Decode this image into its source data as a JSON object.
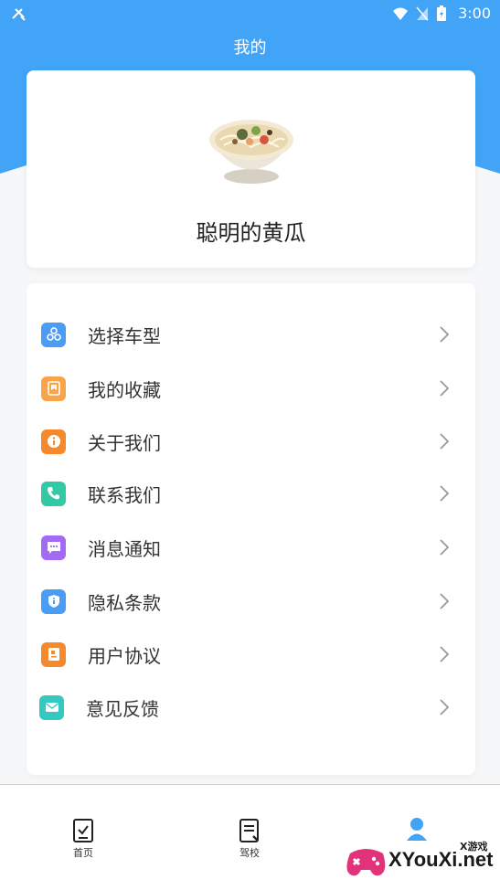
{
  "status_bar": {
    "time": "3:00"
  },
  "header": {
    "title": "我的"
  },
  "profile": {
    "username": "聪明的黄瓜",
    "avatar": "noodle-bowl-avatar"
  },
  "menu": {
    "items": [
      {
        "label": "选择车型",
        "icon": "car-model-icon",
        "color": "#4a9cf5"
      },
      {
        "label": "我的收藏",
        "icon": "bookmark-icon",
        "color": "#f7a44a"
      },
      {
        "label": "关于我们",
        "icon": "info-icon",
        "color": "#f5892d"
      },
      {
        "label": "联系我们",
        "icon": "phone-icon",
        "color": "#34c9a5"
      },
      {
        "label": "消息通知",
        "icon": "message-icon",
        "color": "#a36af5"
      },
      {
        "label": "隐私条款",
        "icon": "shield-icon",
        "color": "#4a9cf5"
      },
      {
        "label": "用户协议",
        "icon": "agreement-icon",
        "color": "#f5892d"
      },
      {
        "label": "意见反馈",
        "icon": "mail-icon",
        "color": "#34c9c0"
      }
    ]
  },
  "bottom_nav": {
    "home_label": "首页",
    "school_label": "驾校"
  },
  "watermark": {
    "text": "XYouXi.net",
    "small": "X游戏"
  },
  "colors": {
    "accent": "#42a4f7"
  }
}
